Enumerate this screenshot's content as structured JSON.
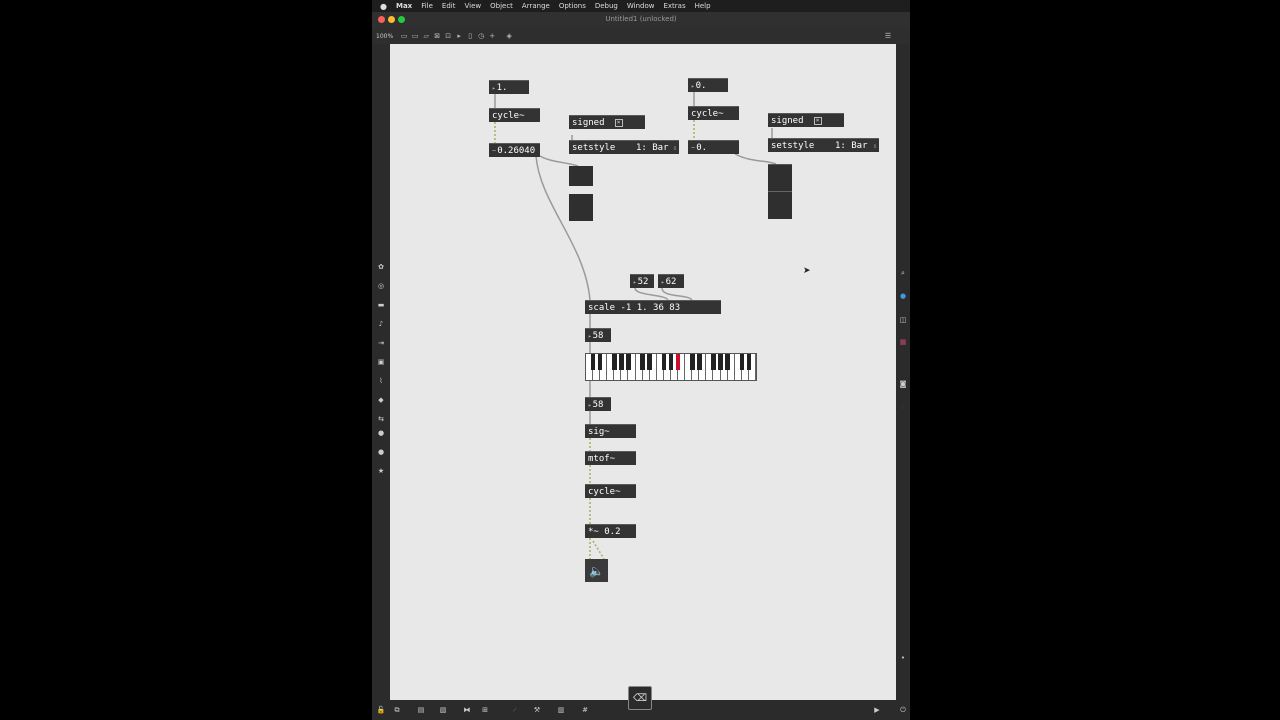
{
  "menubar": {
    "apple": "",
    "items": [
      "Max",
      "File",
      "Edit",
      "View",
      "Object",
      "Arrange",
      "Options",
      "Debug",
      "Window",
      "Extras",
      "Help"
    ]
  },
  "window": {
    "title": "Untitled1 (unlocked)"
  },
  "toolbar": {
    "zoom": "100%"
  },
  "patch": {
    "left": {
      "float_in": "1.",
      "cycle": "cycle~",
      "signal_num": "0.26040",
      "signed_msg": "signed",
      "toggle_glyph": "×",
      "setstyle_msg": "setstyle",
      "style_menu": "1: Bar"
    },
    "right": {
      "float_in": "0.",
      "cycle": "cycle~",
      "signal_num": "0.",
      "signed_msg": "signed",
      "toggle_glyph": "×",
      "setstyle_msg": "setstyle",
      "style_menu": "1: Bar"
    },
    "chain": {
      "low_num": "52",
      "high_num": "62",
      "scale": "scale -1 1. 36 83",
      "note_num_top": "58",
      "note_num_bottom": "58",
      "sig": "sig~",
      "mtof": "mtof~",
      "cycle": "cycle~",
      "gain": "*~ 0.2"
    },
    "keyboard": {
      "active_note": 58,
      "highlight_color": "#c8102e"
    }
  },
  "bottombar": {
    "delete_glyph": "⌫"
  },
  "colors": {
    "canvas": "#e8e8e8",
    "object": "#333333",
    "cable": "#9a9a9a",
    "signal_cable": "#a8b060"
  }
}
